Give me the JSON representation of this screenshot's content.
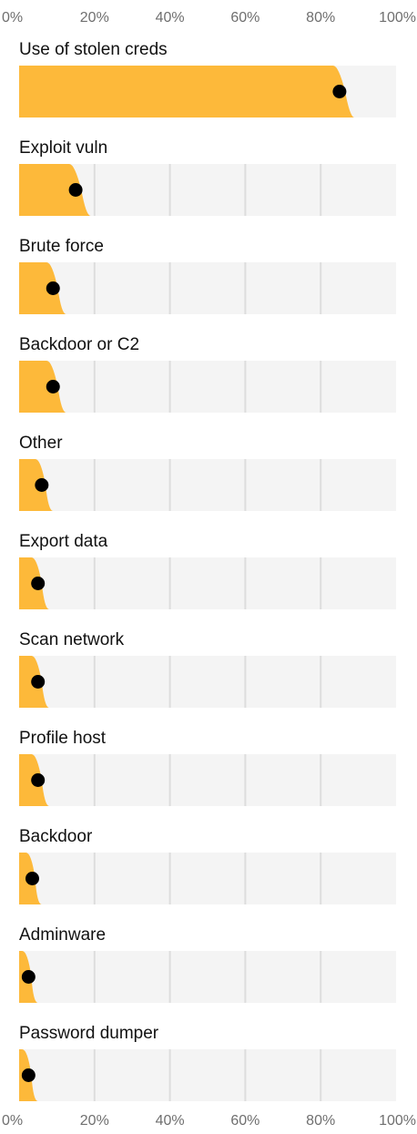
{
  "chart_data": {
    "type": "bar",
    "subtype": "dot-and-distribution",
    "xlim": [
      0,
      100
    ],
    "x_ticks": [
      "0%",
      "20%",
      "40%",
      "60%",
      "80%",
      "100%"
    ],
    "axis_positions": [
      "top",
      "bottom"
    ],
    "grid": true,
    "colors": {
      "fill": "#FDB93A",
      "track": "#F4F4F4",
      "grid": "#DDDDDD",
      "dot": "#000000",
      "tick_text": "#6F6F6F",
      "label_text": "#111111"
    },
    "categories": [
      "Use of stolen creds",
      "Exploit vuln",
      "Brute force",
      "Backdoor or C2",
      "Other",
      "Export data",
      "Scan network",
      "Profile host",
      "Backdoor",
      "Adminware",
      "Password dumper"
    ],
    "values": [
      85,
      15,
      9,
      9,
      6,
      5,
      5,
      5,
      3.5,
      2.5,
      2.5
    ],
    "upper_bounds": [
      88,
      18,
      11.5,
      11.5,
      8,
      7,
      7,
      7,
      5,
      4,
      4
    ]
  }
}
